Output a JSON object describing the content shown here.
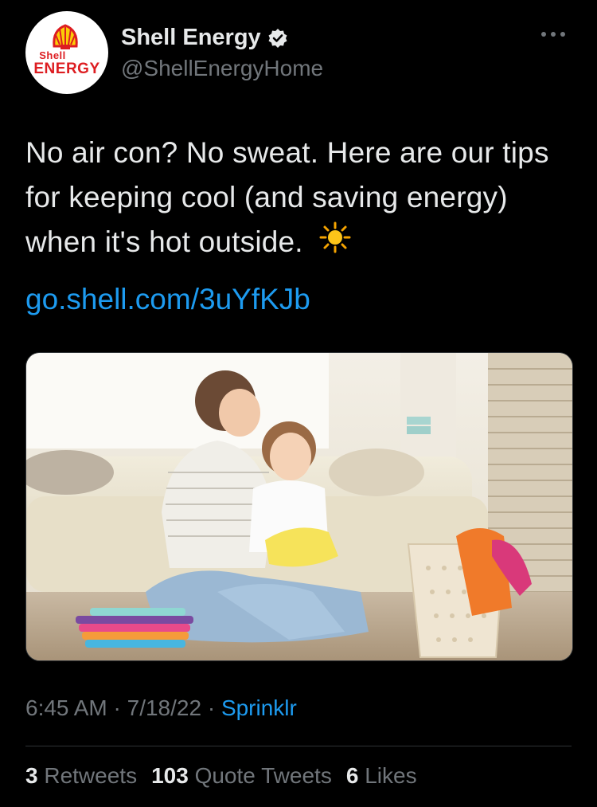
{
  "author": {
    "display_name": "Shell Energy",
    "handle": "@ShellEnergyHome",
    "avatar_logo_text": [
      "Shell",
      "ENERGY"
    ],
    "verified_icon": "verified-badge-icon",
    "brand_color": "#dd1d21",
    "accent_color": "#fbce07"
  },
  "tweet": {
    "text": "No air con? No sweat. Here are our tips for keeping cool (and saving energy) when it's hot outside.",
    "emoji": "sun-icon",
    "link": "go.shell.com/3uYfKJb",
    "media_description_icon": "photo-mother-daughter-laundry"
  },
  "meta": {
    "time": "6:45 AM",
    "sep1": " · ",
    "date": "7/18/22",
    "sep2": " · ",
    "source": "Sprinklr"
  },
  "stats": {
    "retweets_count": "3",
    "retweets_label": "Retweets",
    "quote_count": "103",
    "quote_label": "Quote Tweets",
    "likes_count": "6",
    "likes_label": "Likes"
  },
  "colors": {
    "background": "#000000",
    "text_primary": "#e7e9ea",
    "text_secondary": "#71767b",
    "link": "#1d9bf0",
    "divider": "#2f3336"
  }
}
